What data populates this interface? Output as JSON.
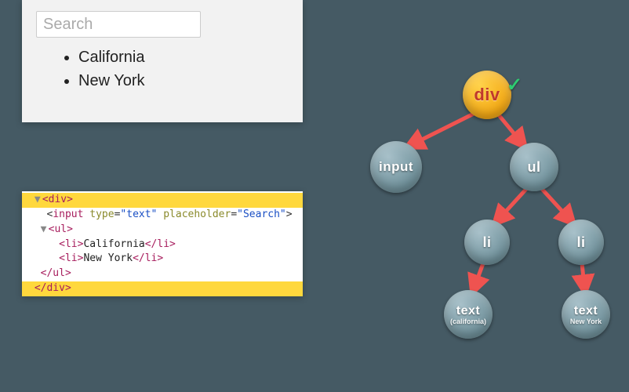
{
  "ui": {
    "search_placeholder": "Search",
    "items": [
      "California",
      "New York"
    ]
  },
  "code": {
    "l1_arrow": "▼",
    "l1_open": "<div>",
    "l2": "  <input type=\"text\" placeholder=\"Search\">",
    "l3_arrow": "▼",
    "l3_open": "<ul>",
    "l4_open": "<li>",
    "l4_text": "California",
    "l4_close": "</li>",
    "l5_open": "<li>",
    "l5_text": "New York",
    "l5_close": "</li>",
    "l6": "  </ul>",
    "l7": "</div>"
  },
  "tree": {
    "root": {
      "label": "div"
    },
    "input": {
      "label": "input"
    },
    "ul": {
      "label": "ul"
    },
    "li1": {
      "label": "li"
    },
    "li2": {
      "label": "li"
    },
    "text1": {
      "label": "text",
      "sub": "(california)"
    },
    "text2": {
      "label": "text",
      "sub": "New York"
    },
    "check": "✓"
  },
  "colors": {
    "bg": "#455a64",
    "highlight": "#ffd83d",
    "root_node": "#f3a712",
    "node": "#6b8d97",
    "edge": "#ef5350"
  }
}
